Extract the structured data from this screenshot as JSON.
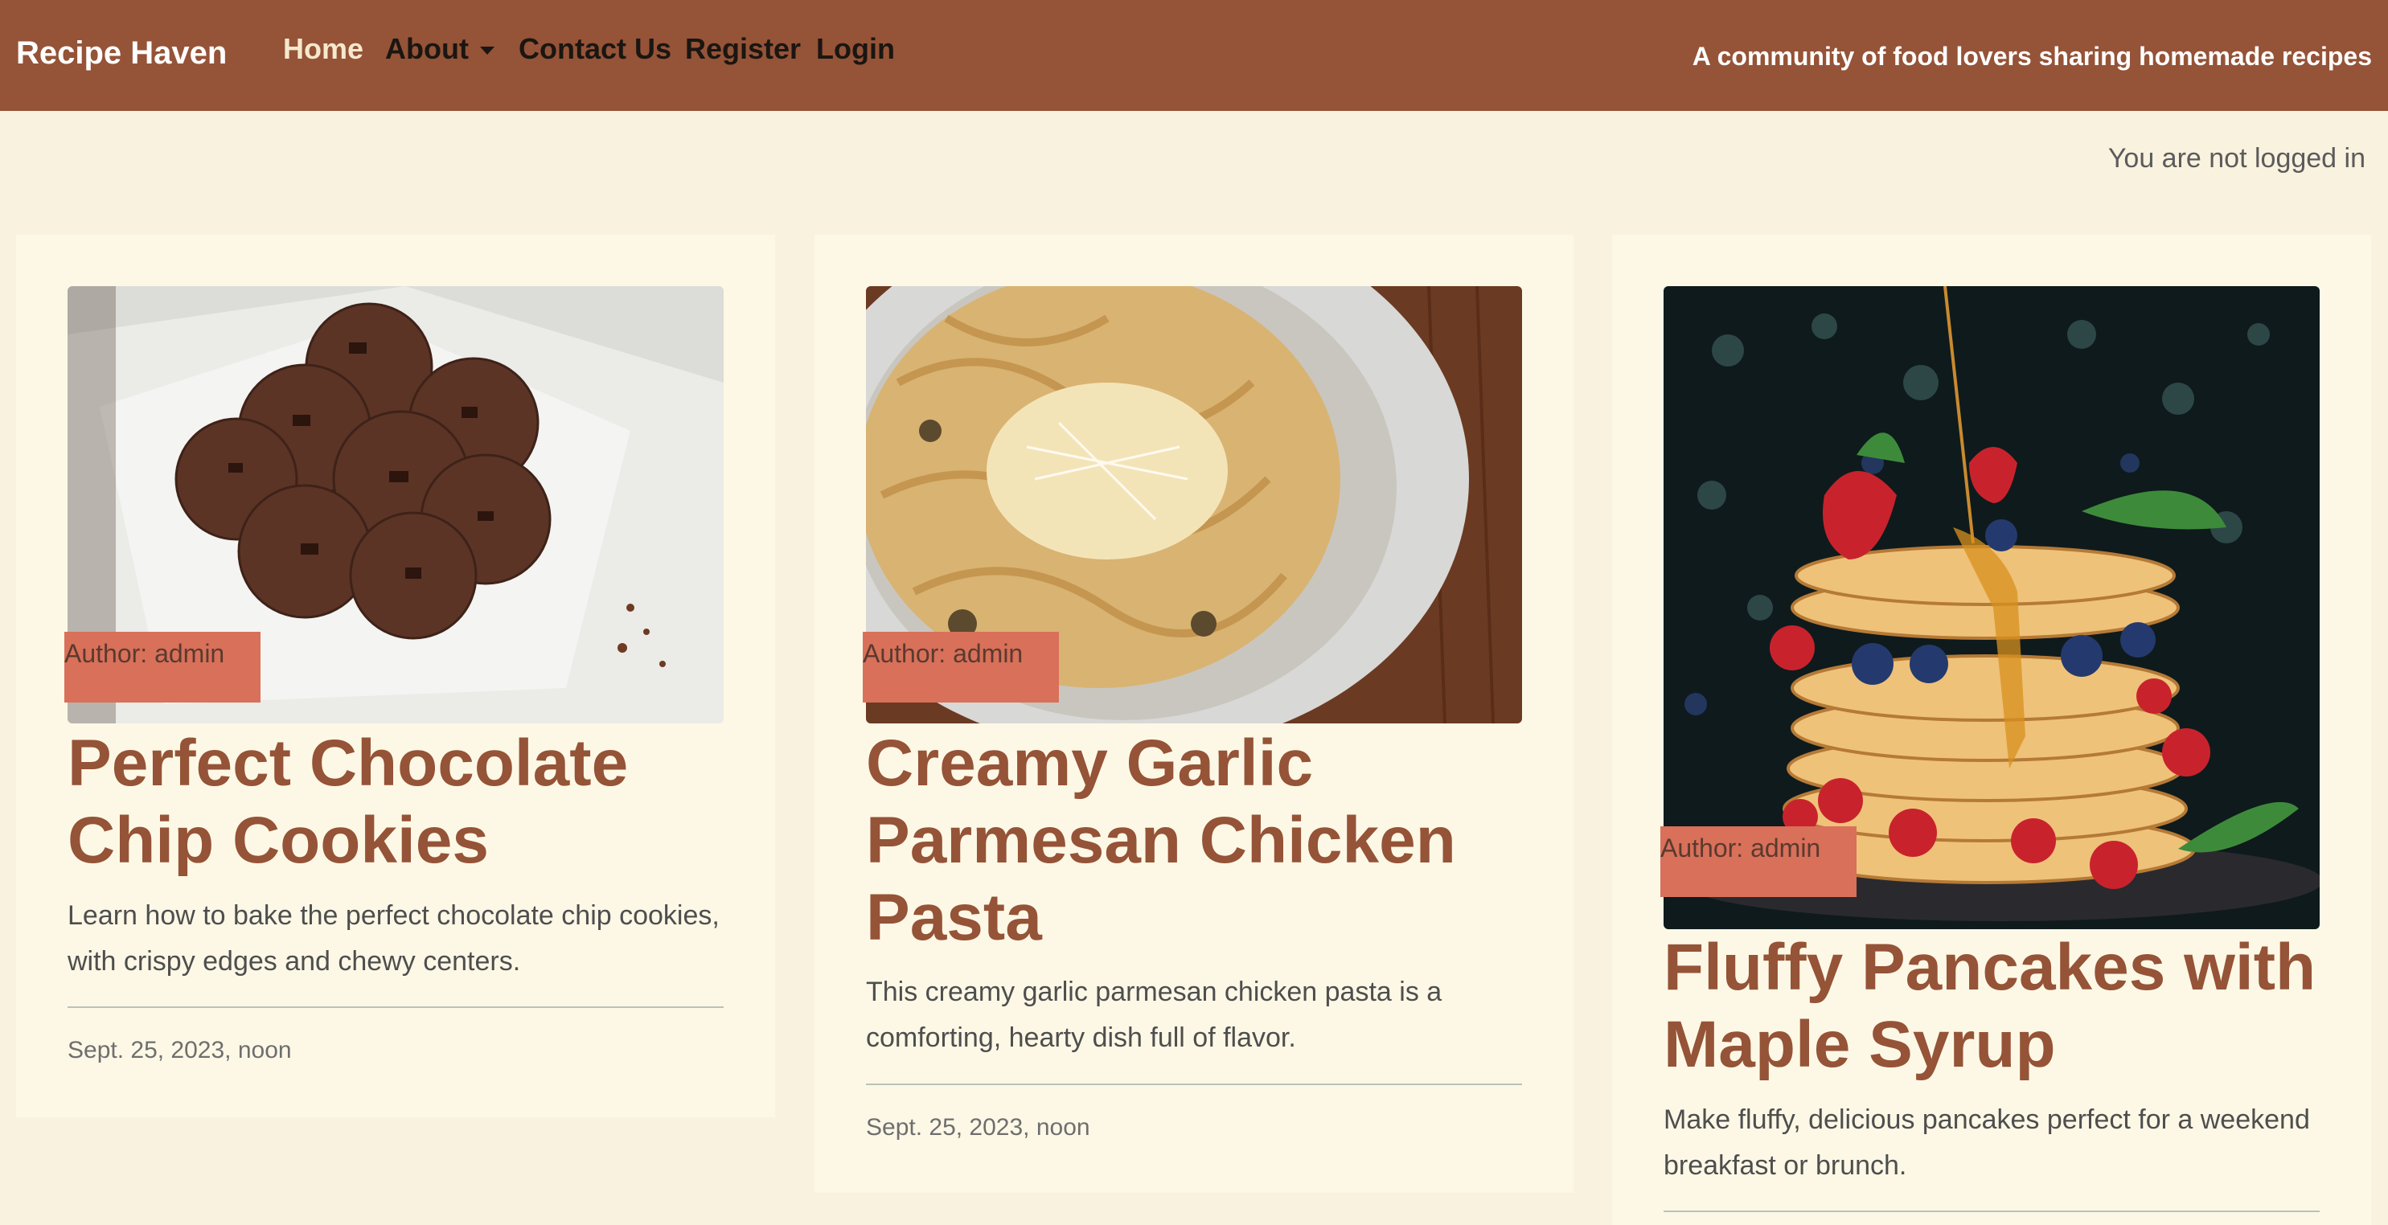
{
  "nav": {
    "brand": "Recipe Haven",
    "items": [
      {
        "label": "Home"
      },
      {
        "label": "About"
      },
      {
        "label": "Contact Us"
      },
      {
        "label": "Register"
      },
      {
        "label": "Login"
      }
    ],
    "tagline": "A community of food lovers sharing homemade recipes"
  },
  "status": "You are not logged in",
  "cards": [
    {
      "image": "chocolate-chip-cookies-photo",
      "author": "Author: admin",
      "title": "Perfect Chocolate Chip Cookies",
      "description": "Learn how to bake the perfect chocolate chip cookies, with crispy edges and chewy centers.",
      "date": "Sept. 25, 2023, noon"
    },
    {
      "image": "garlic-parmesan-pasta-photo",
      "author": "Author: admin",
      "title": "Creamy Garlic Parmesan Chicken Pasta",
      "description": "This creamy garlic parmesan chicken pasta is a comforting, hearty dish full of flavor.",
      "date": "Sept. 25, 2023, noon"
    },
    {
      "image": "fluffy-pancakes-photo",
      "author": "Author: admin",
      "title": "Fluffy Pancakes with Maple Syrup",
      "description": "Make fluffy, delicious pancakes perfect for a weekend breakfast or brunch.",
      "date": ""
    }
  ],
  "colors": {
    "navbar": "#955337",
    "background": "#f9f2df",
    "card": "#fdf8e6",
    "author_tag": "#d9705a",
    "title": "#955337"
  }
}
